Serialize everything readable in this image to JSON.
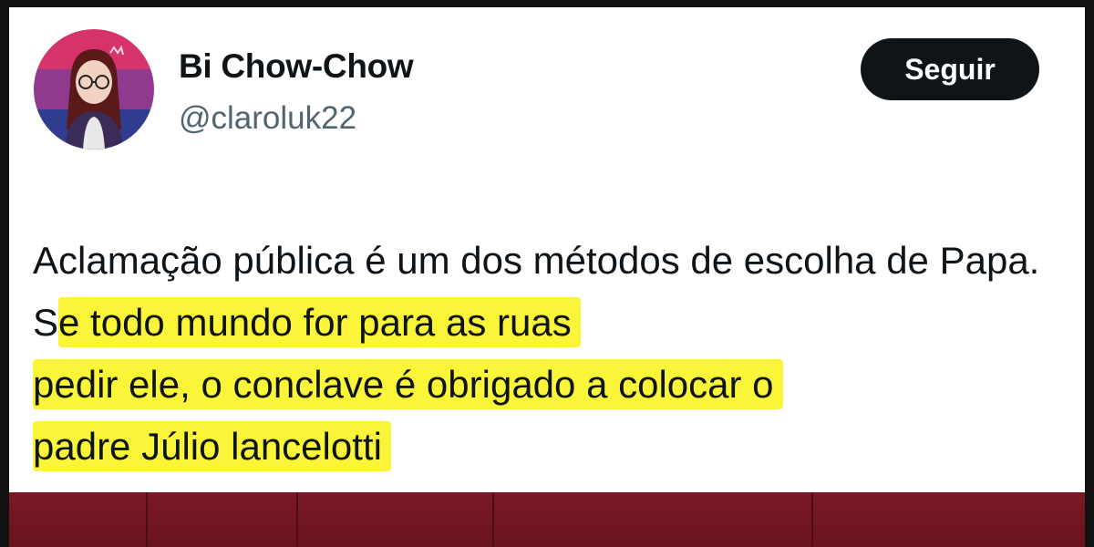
{
  "tweet": {
    "display_name": "Bi Chow-Chow",
    "handle": "@claroluk22",
    "follow_label": "Seguir",
    "text_plain": "Aclamação pública é um dos métodos de escolha de Papa. S",
    "text_highlight_line1": "e todo mundo for para as ruas",
    "text_highlight_line2": "pedir ele, o conclave é obrigado a colocar o",
    "text_highlight_line3": "padre Júlio lancelotti",
    "highlight_color": "#fbf53a"
  },
  "avatar": {
    "icon": "woman-with-glasses-avatar-icon",
    "stripes": [
      "#d6336c",
      "#8f3a8f",
      "#2f3c8f"
    ]
  },
  "background": {
    "color": "#7a1824"
  }
}
